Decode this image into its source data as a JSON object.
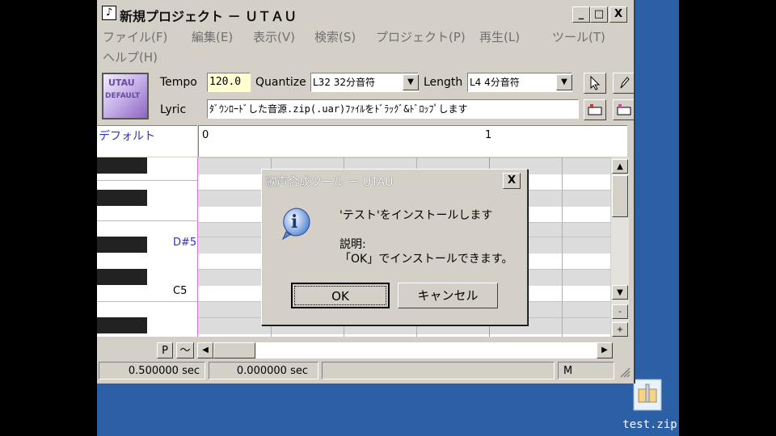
{
  "window": {
    "title": "新規プロジェクト － ＵＴＡＵ",
    "caption": {
      "minimize": "_",
      "maximize": "□",
      "close": "X"
    }
  },
  "menu": [
    "ファイル(F)",
    "編集(E)",
    "表示(V)",
    "検索(S)",
    "プロジェクト(P)",
    "再生(L)",
    "ツール(T)",
    "ヘルプ(H)"
  ],
  "logo": {
    "line1": "UTAU",
    "line2": "DEFAULT"
  },
  "toolbar": {
    "tempo_label": "Tempo",
    "tempo_value": "120.0",
    "quantize_label": "Quantize",
    "quantize_value": "L32 32分音符",
    "length_label": "Length",
    "length_value": "L4  4分音符",
    "lyric_label": "Lyric",
    "lyric_value": "ﾀﾞｳﾝﾛｰﾄﾞした音源.zip(.uar)ﾌｧｲﾙをﾄﾞﾗｯｸﾞ&ﾄﾞﾛｯﾌﾟします",
    "select_arrow": "▼"
  },
  "track": {
    "name": "デフォルト"
  },
  "ruler": {
    "marks": [
      "0",
      "1"
    ]
  },
  "piano": {
    "labels": [
      "D#5",
      "C5"
    ]
  },
  "bottom": {
    "p_button": "P",
    "tilde_button": "～",
    "left_arrow": "◀",
    "right_arrow": "▶"
  },
  "vscroll": {
    "up": "▲",
    "down": "▼",
    "minus": "-",
    "plus": "+"
  },
  "status": {
    "time1": "0.500000 sec",
    "time2": "0.000000 sec",
    "mode": "M"
  },
  "dialog": {
    "title": "歌声合成ツール － UTAU",
    "close": "X",
    "icon": "i",
    "message": "'テスト'をインストールします",
    "desc_label": "説明:",
    "desc_text": "「OK」でインストールできます。",
    "ok": "OK",
    "cancel": "キャンセル"
  },
  "desktop": {
    "file_label": "test.zip"
  }
}
